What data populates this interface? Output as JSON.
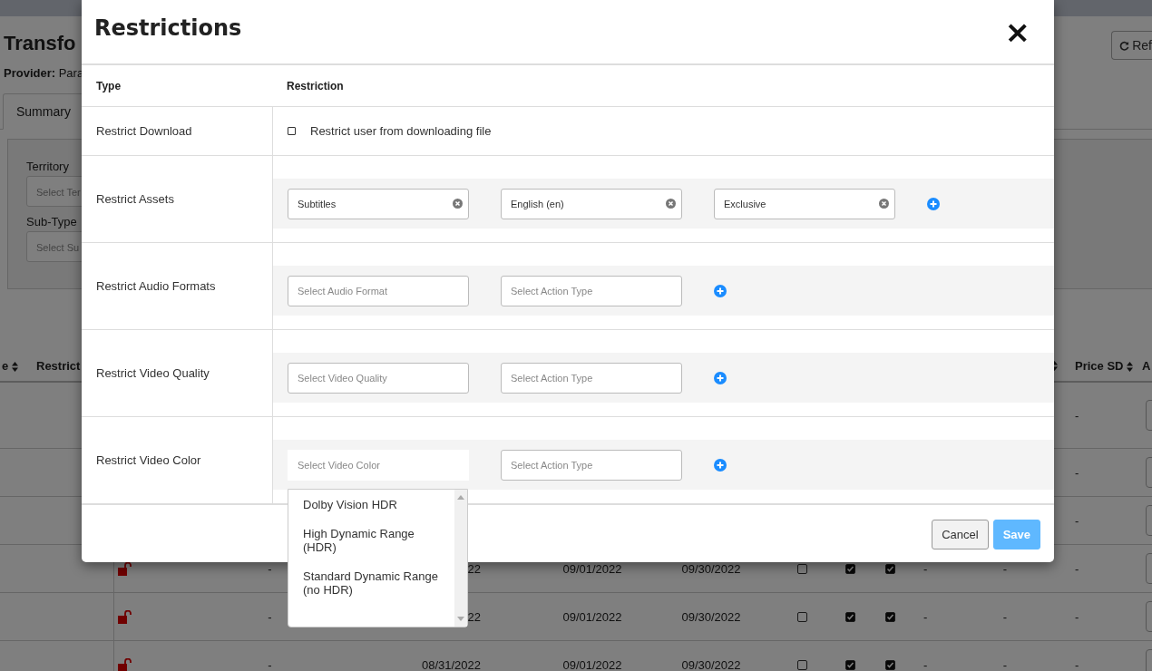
{
  "background": {
    "title": "Transfo",
    "provider": "**Provider:** Para",
    "refresh_button": "Ref",
    "tabs": [
      {
        "label": "Summary",
        "selected": true
      }
    ],
    "filters": [
      {
        "label": "Territory",
        "placeholder": "Select Ter"
      },
      {
        "label": "Sub-Type",
        "placeholder": "Select Su"
      }
    ],
    "table": {
      "headers": {
        "column_1": "e",
        "column_2": "Restrict",
        "price_sd": "Price SD",
        "column_last": "A"
      },
      "rows": [
        {
          "price_sd": "-"
        },
        {
          "price_sd": "-"
        },
        {
          "price_sd": "-"
        },
        {
          "locked": false,
          "column_4": "-",
          "date_1": "22",
          "date_2": "09/01/2022",
          "date_3": "09/30/2022",
          "check_1": false,
          "check_2": true,
          "check_3": true,
          "column_12": "-",
          "column_13": "-",
          "price_sd": "-"
        },
        {
          "locked": false,
          "column_4": "-",
          "date_1": "22",
          "date_2": "09/01/2022",
          "date_3": "09/30/2022",
          "check_1": false,
          "check_2": true,
          "check_3": true,
          "column_12": "-",
          "column_13": "-",
          "price_sd": "-"
        },
        {
          "locked": false,
          "column_4": "-",
          "date_1": "08/31/2022",
          "date_2": "09/01/2022",
          "date_3": "09/30/2022",
          "check_1": false,
          "check_2": true,
          "check_3": true,
          "column_12": "-",
          "column_13": "-",
          "price_sd": "-"
        }
      ]
    }
  },
  "modal": {
    "title": "Restrictions",
    "close": "×",
    "columns": [
      "Type",
      "Restriction"
    ],
    "rows": [
      {
        "type": "Restrict Download",
        "kind": "checkbox",
        "checked": false,
        "label": "Restrict user from downloading file"
      },
      {
        "type": "Restrict Assets",
        "kind": "selects",
        "fields": [
          {
            "value": "Subtitles",
            "open": false
          },
          {
            "value": "English (en)",
            "open": false
          },
          {
            "value": "Exclusive",
            "open": false
          }
        ]
      },
      {
        "type": "Restrict Audio Formats",
        "kind": "selects",
        "fields": [
          {
            "placeholder": "Select Audio Format",
            "open": false
          },
          {
            "placeholder": "Select Action Type",
            "open": false
          }
        ]
      },
      {
        "type": "Restrict Video Quality",
        "kind": "selects",
        "fields": [
          {
            "placeholder": "Select Video Quality",
            "open": false
          },
          {
            "placeholder": "Select Action Type",
            "open": false
          }
        ]
      },
      {
        "type": "Restrict Video Color",
        "kind": "selects",
        "fields": [
          {
            "placeholder": "Select Video Color",
            "open": true,
            "options": [
              "Dolby Vision HDR",
              "High Dynamic Range (HDR)",
              "Standard Dynamic Range (no HDR)"
            ]
          },
          {
            "placeholder": "Select Action Type",
            "open": false
          }
        ]
      }
    ],
    "buttons": [
      {
        "label": "Cancel",
        "kind": "secondary",
        "disabled": false
      },
      {
        "label": "Save",
        "kind": "primary",
        "disabled": true
      }
    ]
  }
}
